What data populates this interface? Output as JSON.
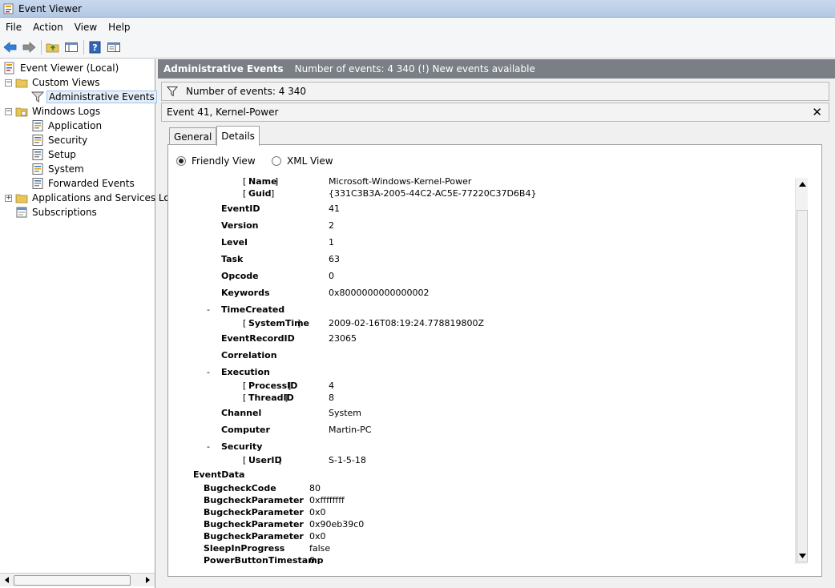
{
  "window": {
    "title": "Event Viewer"
  },
  "menu": [
    "File",
    "Action",
    "View",
    "Help"
  ],
  "toolbar_icons": [
    "back-arrow-icon",
    "forward-arrow-icon",
    "up-folder-icon",
    "show-hide-console-tree-icon",
    "help-icon",
    "properties-icon"
  ],
  "tree": {
    "root": "Event Viewer (Local)",
    "custom_views": "Custom Views",
    "administrative_events": "Administrative Events",
    "windows_logs": "Windows Logs",
    "application": "Application",
    "security": "Security",
    "setup": "Setup",
    "system": "System",
    "forwarded_events": "Forwarded Events",
    "applications_services": "Applications and Services Lo",
    "subscriptions": "Subscriptions"
  },
  "header": {
    "title": "Administrative Events",
    "info": "Number of events: 4 340 (!) New events available"
  },
  "filter": {
    "text": "Number of events: 4 340"
  },
  "event": {
    "title": "Event 41, Kernel-Power"
  },
  "tabs": {
    "general": "General",
    "details": "Details"
  },
  "view_options": {
    "friendly": "Friendly View",
    "xml": "XML View"
  },
  "details": {
    "provider_name_key": "Name",
    "provider_name_value": "Microsoft-Windows-Kernel-Power",
    "provider_guid_key": "Guid",
    "provider_guid_value": "{331C3B3A-2005-44C2-AC5E-77220C37D6B4}",
    "eventid_key": "EventID",
    "eventid_value": "41",
    "version_key": "Version",
    "version_value": "2",
    "level_key": "Level",
    "level_value": "1",
    "task_key": "Task",
    "task_value": "63",
    "opcode_key": "Opcode",
    "opcode_value": "0",
    "keywords_key": "Keywords",
    "keywords_value": "0x8000000000000002",
    "timecreated_key": "TimeCreated",
    "systemtime_key": "SystemTime",
    "systemtime_value": "2009-02-16T08:19:24.778819800Z",
    "recordid_key": "EventRecordID",
    "recordid_value": "23065",
    "correlation_key": "Correlation",
    "execution_key": "Execution",
    "processid_key": "ProcessID",
    "processid_value": "4",
    "threadid_key": "ThreadID",
    "threadid_value": "8",
    "channel_key": "Channel",
    "channel_value": "System",
    "computer_key": "Computer",
    "computer_value": "Martin-PC",
    "security_key": "Security",
    "userid_key": "UserID",
    "userid_value": "S-1-5-18",
    "eventdata_key": "EventData",
    "bugcheckcode_key": "BugcheckCode",
    "bugcheckcode_value": "80",
    "bp1_key": "BugcheckParameter",
    "bp1_value": "0xffffffff",
    "bp2_key": "BugcheckParameter",
    "bp2_value": "0x0",
    "bp3_key": "BugcheckParameter",
    "bp3_value": "0x90eb39c0",
    "bp4_key": "BugcheckParameter",
    "bp4_value": "0x0",
    "sleep_key": "SleepInProgress",
    "sleep_value": "false",
    "pbt_key": "PowerButtonTimestamp",
    "pbt_value": "0",
    "bracket_open": "[",
    "bracket_close": "]",
    "collapse_marker": "-"
  }
}
